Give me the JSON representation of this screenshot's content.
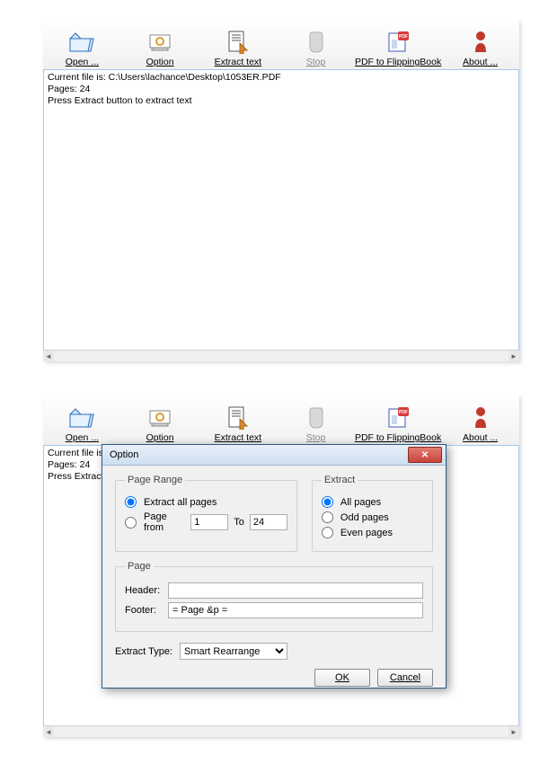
{
  "toolbar": {
    "open": "Open ...",
    "option": "Option",
    "extract": "Extract text",
    "stop": "Stop",
    "pdf2flip": "PDF to FlippingBook",
    "about": "About ..."
  },
  "status": {
    "line1": "Current file is: C:\\Users\\lachance\\Desktop\\1053ER.PDF",
    "line2": "Pages: 24",
    "line3": "Press Extract button to extract text",
    "line1_trunc": "Current file is: C",
    "line3_trunc": "Press Extract b"
  },
  "dialog": {
    "title": "Option",
    "range_legend": "Page Range",
    "extract_legend": "Extract",
    "page_legend": "Page",
    "opt_all": "Extract all pages",
    "opt_from": "Page from",
    "to_label": "To",
    "from_value": "1",
    "to_value": "24",
    "ext_all": "All pages",
    "ext_odd": "Odd pages",
    "ext_even": "Even pages",
    "header_label": "Header:",
    "header_value": "",
    "footer_label": "Footer:",
    "footer_value": "= Page &p =",
    "extract_type_label": "Extract Type:",
    "extract_type_value": "Smart Rearrange",
    "ok": "OK",
    "cancel": "Cancel"
  }
}
